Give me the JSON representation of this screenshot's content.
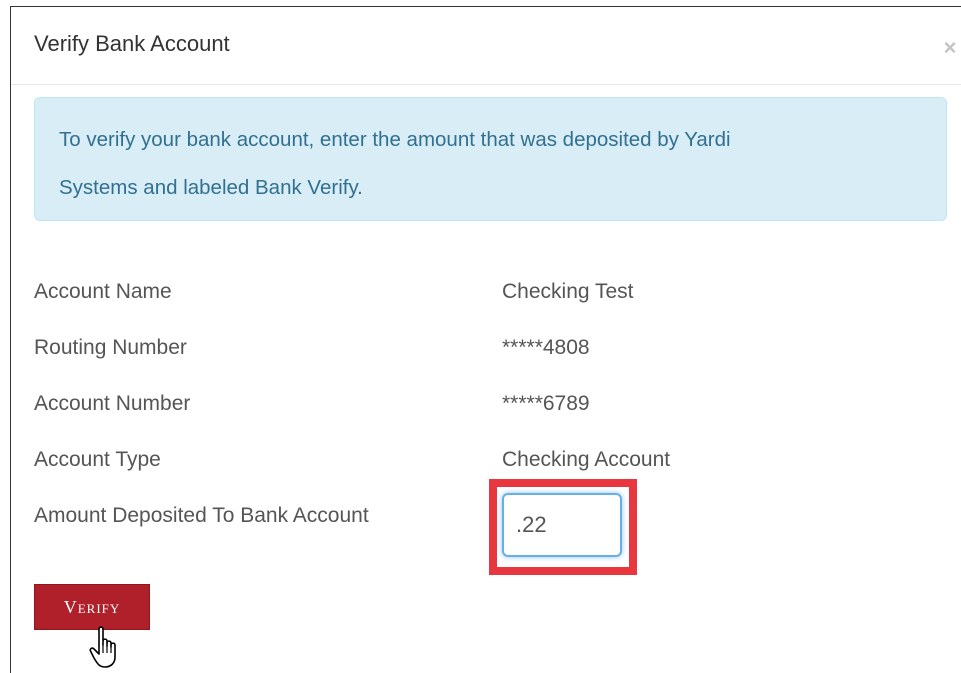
{
  "dialog": {
    "title": "Verify Bank Account",
    "close_label": "×",
    "info_line1": "To verify your bank account, enter the amount that was deposited by Yardi",
    "info_line2": "Systems and labeled Bank Verify."
  },
  "fields": [
    {
      "label": "Account Name",
      "value": "Checking Test"
    },
    {
      "label": "Routing Number",
      "value": "*****4808"
    },
    {
      "label": "Account Number",
      "value": "*****6789"
    },
    {
      "label": "Account Type",
      "value": "Checking Account"
    }
  ],
  "amount": {
    "label": "Amount Deposited To Bank Account",
    "value": ".22"
  },
  "verify_button": {
    "label": "Verify"
  },
  "colors": {
    "info_bg": "#d9edf7",
    "info_text": "#31708f",
    "button_bg": "#b0202a",
    "highlight": "#e8373e",
    "input_focus": "#66afe9"
  },
  "icons": {
    "close": "close-icon",
    "cursor": "hand-pointer-icon"
  }
}
